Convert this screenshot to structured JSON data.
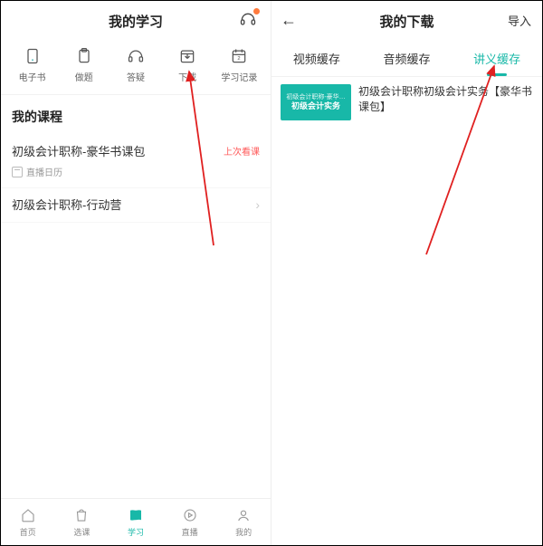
{
  "left": {
    "header": {
      "title": "我的学习"
    },
    "shortcuts": [
      {
        "id": "ebook",
        "label": "电子书"
      },
      {
        "id": "practice",
        "label": "做题"
      },
      {
        "id": "qa",
        "label": "答疑"
      },
      {
        "id": "download",
        "label": "下载"
      },
      {
        "id": "record",
        "label": "学习记录"
      }
    ],
    "section_title": "我的课程",
    "courses": [
      {
        "title": "初级会计职称-豪华书课包",
        "badge": "上次看课",
        "sub": "直播日历"
      },
      {
        "title": "初级会计职称-行动营",
        "badge": "",
        "sub": ""
      }
    ],
    "bottom_nav": [
      {
        "id": "home",
        "label": "首页"
      },
      {
        "id": "select",
        "label": "选课"
      },
      {
        "id": "study",
        "label": "学习",
        "active": true
      },
      {
        "id": "live",
        "label": "直播"
      },
      {
        "id": "mine",
        "label": "我的"
      }
    ]
  },
  "right": {
    "header": {
      "title": "我的下载",
      "action": "导入"
    },
    "tabs": [
      {
        "id": "video",
        "label": "视频缓存"
      },
      {
        "id": "audio",
        "label": "音频缓存"
      },
      {
        "id": "lecture",
        "label": "讲义缓存",
        "active": true
      }
    ],
    "items": [
      {
        "thumb_top": "初级会计职称-豪华…",
        "thumb_mid": "初级会计实务",
        "title": "初级会计职称初级会计实务【豪华书课包】"
      }
    ]
  },
  "colors": {
    "accent": "#18b8a8",
    "warn": "#ff5a5a"
  }
}
